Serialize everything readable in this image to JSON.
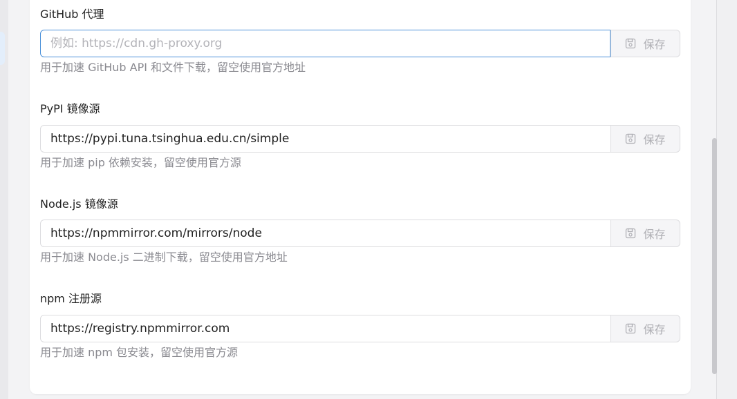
{
  "fields": [
    {
      "label": "GitHub 代理",
      "value": "",
      "placeholder": "例如: https://cdn.gh-proxy.org",
      "button": "保存",
      "hint": "用于加速 GitHub API 和文件下载，留空使用官方地址"
    },
    {
      "label": "PyPI 镜像源",
      "value": "https://pypi.tuna.tsinghua.edu.cn/simple",
      "placeholder": "",
      "button": "保存",
      "hint": "用于加速 pip 依赖安装，留空使用官方源"
    },
    {
      "label": "Node.js 镜像源",
      "value": "https://npmmirror.com/mirrors/node",
      "placeholder": "",
      "button": "保存",
      "hint": "用于加速 Node.js 二进制下载，留空使用官方地址"
    },
    {
      "label": "npm 注册源",
      "value": "https://registry.npmmirror.com",
      "placeholder": "",
      "button": "保存",
      "hint": "用于加速 npm 包安装，留空使用官方源"
    }
  ],
  "icons": {
    "save": "save-icon"
  },
  "colors": {
    "focus_border": "#4a90d9",
    "hint_text": "#8a8a90",
    "button_text": "#b0b0b5"
  }
}
